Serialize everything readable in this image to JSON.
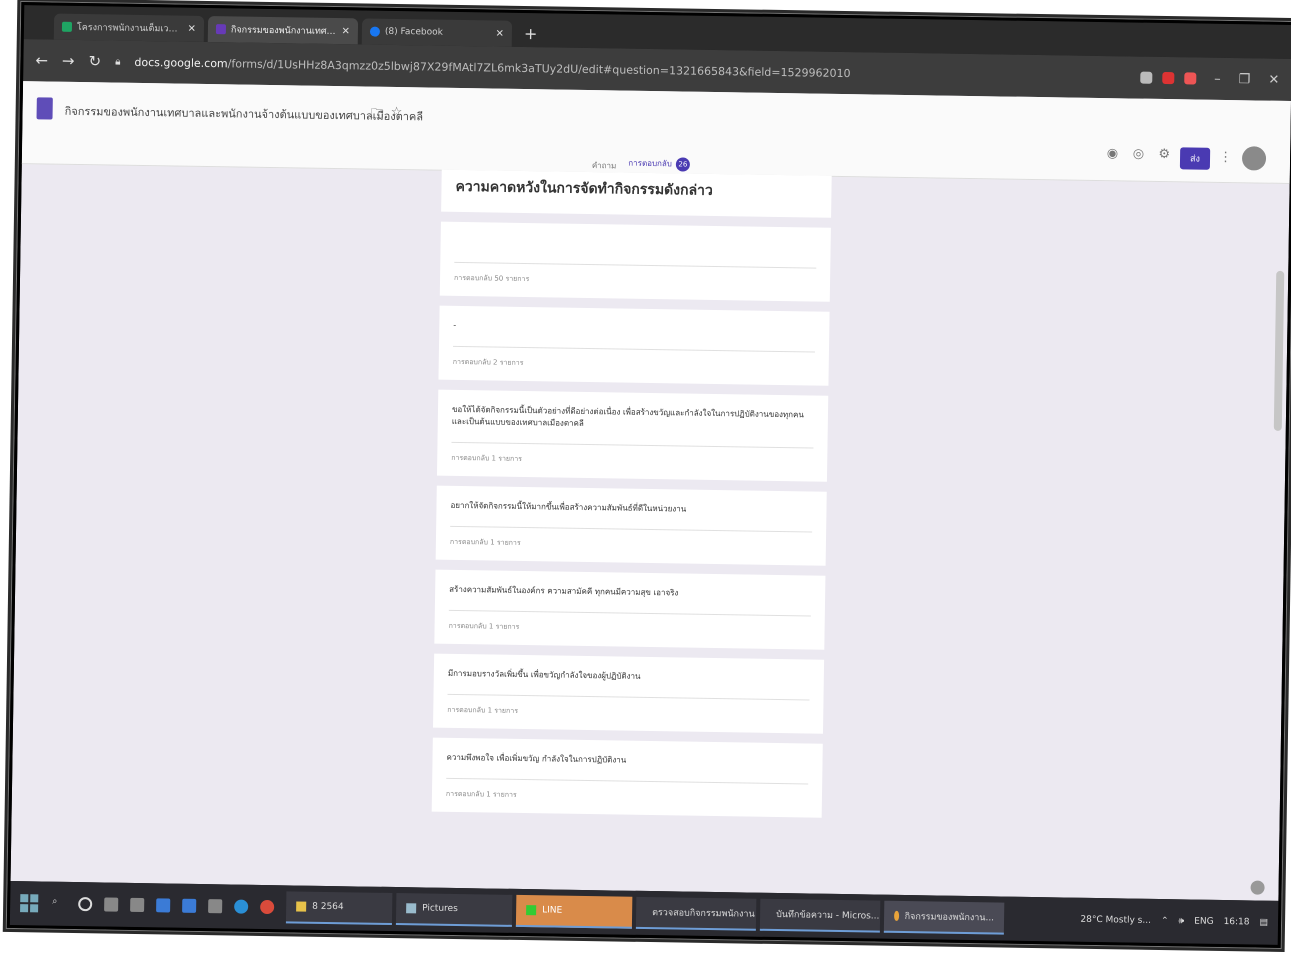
{
  "browser": {
    "tabs": [
      {
        "label": "โครงการพนักงานเต็มเวลา - Google ชีต",
        "icon_color": "#1fa463"
      },
      {
        "label": "กิจกรรมของพนักงานเทศบาลและพนักงานจ้าง",
        "icon_color": "#673ab7"
      },
      {
        "label": "(8) Facebook",
        "icon_color": "#1877f2"
      }
    ],
    "url_host": "docs.google.com",
    "url_path": "/forms/d/1UsHHz8A3qmzz0z5lbwj87X29fMAtl7ZL6mk3aTUy2dU/edit#question=1321665843&field=1529962010"
  },
  "forms": {
    "title": "กิจกรรมของพนักงานเทศบาลและพนักงานจ้างต้นแบบของเทศบาลเมืองตาคลี",
    "send_label": "ส่ง",
    "tab_questions": "คำถาม",
    "tab_responses": "การตอบกลับ",
    "responses_count": "26"
  },
  "question": {
    "title": "ความคาดหวังในการจัดทำกิจกรรมดังกล่าว"
  },
  "answers": [
    {
      "text": "",
      "count": "การตอบกลับ 50 รายการ"
    },
    {
      "text": "-",
      "count": "การตอบกลับ 2 รายการ"
    },
    {
      "text": "ขอให้ได้จัดกิจกรรมนี้เป็นตัวอย่างที่ดีอย่างต่อเนื่อง เพื่อสร้างขวัญและกำลังใจในการปฏิบัติงานของทุกคน และเป็นต้นแบบของเทศบาลเมืองตาคลี",
      "count": "การตอบกลับ 1 รายการ"
    },
    {
      "text": "อยากให้จัดกิจกรรมนี้ให้มากขึ้นเพื่อสร้างความสัมพันธ์ที่ดีในหน่วยงาน",
      "count": "การตอบกลับ 1 รายการ"
    },
    {
      "text": "สร้างความสัมพันธ์ในองค์กร ความสามัคคี ทุกคนมีความสุข เอาจริง",
      "count": "การตอบกลับ 1 รายการ"
    },
    {
      "text": "มีการมอบรางวัลเพิ่มขึ้น เพื่อขวัญกำลังใจของผู้ปฏิบัติงาน",
      "count": "การตอบกลับ 1 รายการ"
    },
    {
      "text": "ความพึงพอใจ เพื่อเพิ่มขวัญ กำลังใจในการปฏิบัติงาน",
      "count": "การตอบกลับ 1 รายการ"
    }
  ],
  "taskbar": {
    "items": [
      {
        "label": "8 2564"
      },
      {
        "label": "Pictures"
      },
      {
        "label": "LINE"
      },
      {
        "label": "ตรวจสอบกิจกรรมพนักงาน"
      },
      {
        "label": "บันทึกข้อความ - Micros..."
      },
      {
        "label": "กิจกรรมของพนักงาน..."
      }
    ],
    "weather": "28°C  Mostly s...",
    "lang": "ENG",
    "time": "16:18"
  }
}
